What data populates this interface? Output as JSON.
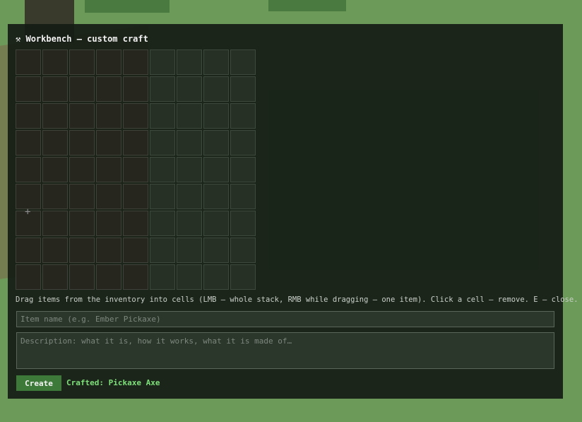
{
  "window": {
    "title_icon": "hammer-pick-icon",
    "title_glyph": "⚒",
    "title": "Workbench — custom craft"
  },
  "grid": {
    "rows": 9,
    "columns": 9
  },
  "cursor_glyph": "+",
  "hint": "Drag items from the inventory into cells (LMB — whole stack, RMB while dragging — one item). Click a cell — remove. E — close.",
  "name_field": {
    "placeholder": "Item name (e.g. Ember Pickaxe)",
    "value": ""
  },
  "description_field": {
    "placeholder": "Description: what it is, how it works, what it is made of…",
    "value": ""
  },
  "create_button": {
    "label": "Create"
  },
  "status": {
    "text": "Crafted: Pickaxe Axe",
    "color": "#7ee07a"
  },
  "colors": {
    "accent": "#3d7a3a",
    "panel": "#141c14"
  }
}
